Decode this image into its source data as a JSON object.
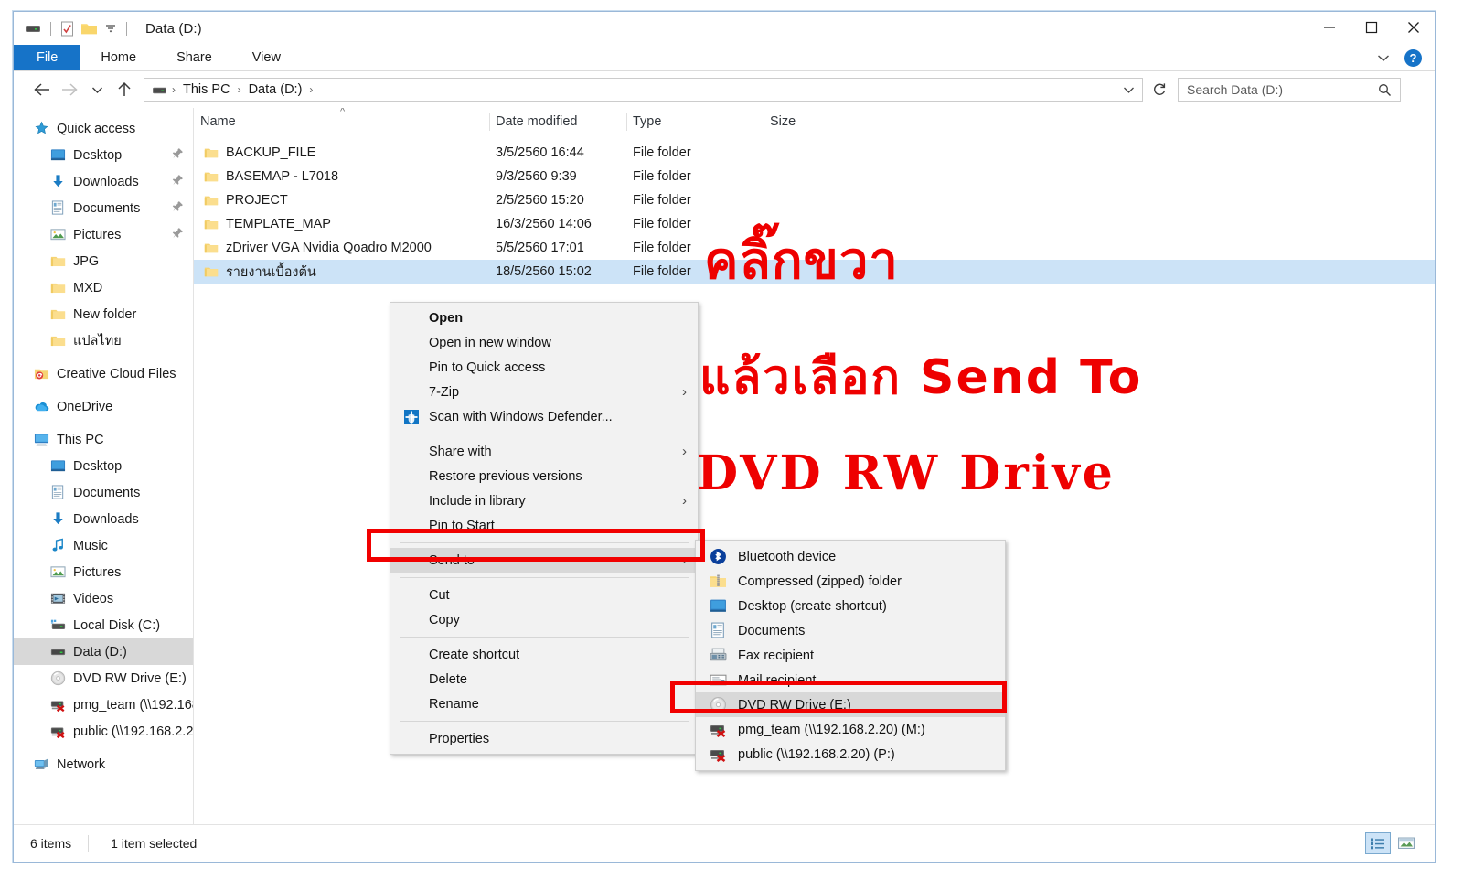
{
  "window": {
    "title": "Data (D:)",
    "quick_access_toolbar": [
      "drive-icon",
      "properties-icon",
      "new-folder-icon",
      "customize-dropdown-icon"
    ],
    "controls": {
      "minimize": "–",
      "maximize": "□",
      "close": "✕"
    }
  },
  "ribbon": {
    "tabs": [
      {
        "label": "File",
        "active": true
      },
      {
        "label": "Home",
        "active": false
      },
      {
        "label": "Share",
        "active": false
      },
      {
        "label": "View",
        "active": false
      }
    ],
    "collapse_label": "⌄",
    "help_label": "?"
  },
  "navbar": {
    "back": "←",
    "forward": "→",
    "recent": "⌄",
    "up": "↑",
    "breadcrumbs": [
      "This PC",
      "Data (D:)"
    ],
    "dropdown": "⌄",
    "refresh": "↻"
  },
  "search": {
    "placeholder": "Search Data (D:)",
    "value": ""
  },
  "sidebar": {
    "items": [
      {
        "label": "Quick access",
        "icon": "star-icon",
        "indent": 0,
        "pinned": false,
        "selected": false
      },
      {
        "label": "Desktop",
        "icon": "desktop-icon",
        "indent": 1,
        "pinned": true,
        "selected": false
      },
      {
        "label": "Downloads",
        "icon": "downloads-icon",
        "indent": 1,
        "pinned": true,
        "selected": false
      },
      {
        "label": "Documents",
        "icon": "documents-icon",
        "indent": 1,
        "pinned": true,
        "selected": false
      },
      {
        "label": "Pictures",
        "icon": "pictures-icon",
        "indent": 1,
        "pinned": true,
        "selected": false
      },
      {
        "label": "JPG",
        "icon": "folder-icon",
        "indent": 1,
        "pinned": false,
        "selected": false
      },
      {
        "label": "MXD",
        "icon": "folder-icon",
        "indent": 1,
        "pinned": false,
        "selected": false
      },
      {
        "label": "New folder",
        "icon": "folder-icon",
        "indent": 1,
        "pinned": false,
        "selected": false
      },
      {
        "label": "แปลไทย",
        "icon": "folder-icon",
        "indent": 1,
        "pinned": false,
        "selected": false
      },
      {
        "label": "Creative Cloud Files",
        "icon": "creative-cloud-icon",
        "indent": 0,
        "pinned": false,
        "selected": false
      },
      {
        "label": "OneDrive",
        "icon": "onedrive-icon",
        "indent": 0,
        "pinned": false,
        "selected": false
      },
      {
        "label": "This PC",
        "icon": "this-pc-icon",
        "indent": 0,
        "pinned": false,
        "selected": false
      },
      {
        "label": "Desktop",
        "icon": "desktop-icon",
        "indent": 1,
        "pinned": false,
        "selected": false
      },
      {
        "label": "Documents",
        "icon": "documents-icon",
        "indent": 1,
        "pinned": false,
        "selected": false
      },
      {
        "label": "Downloads",
        "icon": "downloads-icon",
        "indent": 1,
        "pinned": false,
        "selected": false
      },
      {
        "label": "Music",
        "icon": "music-icon",
        "indent": 1,
        "pinned": false,
        "selected": false
      },
      {
        "label": "Pictures",
        "icon": "pictures-icon",
        "indent": 1,
        "pinned": false,
        "selected": false
      },
      {
        "label": "Videos",
        "icon": "videos-icon",
        "indent": 1,
        "pinned": false,
        "selected": false
      },
      {
        "label": "Local Disk (C:)",
        "icon": "local-disk-icon",
        "indent": 1,
        "pinned": false,
        "selected": false
      },
      {
        "label": "Data (D:)",
        "icon": "drive-icon",
        "indent": 1,
        "pinned": false,
        "selected": true
      },
      {
        "label": "DVD RW Drive (E:)",
        "icon": "dvd-drive-icon",
        "indent": 1,
        "pinned": false,
        "selected": false
      },
      {
        "label": "pmg_team (\\\\192.168",
        "icon": "network-drive-disconnected-icon",
        "indent": 1,
        "pinned": false,
        "selected": false
      },
      {
        "label": "public (\\\\192.168.2.2",
        "icon": "network-drive-disconnected-icon",
        "indent": 1,
        "pinned": false,
        "selected": false
      },
      {
        "label": "Network",
        "icon": "network-icon",
        "indent": 0,
        "pinned": false,
        "selected": false
      }
    ]
  },
  "filelist": {
    "columns": [
      "Name",
      "Date modified",
      "Type",
      "Size"
    ],
    "sort_indicator": "^",
    "rows": [
      {
        "name": "BACKUP_FILE",
        "date": "3/5/2560 16:44",
        "type": "File folder",
        "size": "",
        "selected": false
      },
      {
        "name": "BASEMAP - L7018",
        "date": "9/3/2560 9:39",
        "type": "File folder",
        "size": "",
        "selected": false
      },
      {
        "name": "PROJECT",
        "date": "2/5/2560 15:20",
        "type": "File folder",
        "size": "",
        "selected": false
      },
      {
        "name": "TEMPLATE_MAP",
        "date": "16/3/2560 14:06",
        "type": "File folder",
        "size": "",
        "selected": false
      },
      {
        "name": "zDriver VGA Nvidia Qoadro M2000",
        "date": "5/5/2560 17:01",
        "type": "File folder",
        "size": "",
        "selected": false
      },
      {
        "name": "รายงานเบื้องต้น",
        "date": "18/5/2560 15:02",
        "type": "File folder",
        "size": "",
        "selected": true
      }
    ]
  },
  "context_menu": {
    "items": [
      {
        "label": "Open",
        "bold": true,
        "arrow": false,
        "icon": null,
        "highlighted": false
      },
      {
        "label": "Open in new window",
        "bold": false,
        "arrow": false,
        "icon": null,
        "highlighted": false
      },
      {
        "label": "Pin to Quick access",
        "bold": false,
        "arrow": false,
        "icon": null,
        "highlighted": false
      },
      {
        "label": "7-Zip",
        "bold": false,
        "arrow": true,
        "icon": null,
        "highlighted": false
      },
      {
        "label": "Scan with Windows Defender...",
        "bold": false,
        "arrow": false,
        "icon": "windows-defender-icon",
        "highlighted": false
      },
      {
        "separator": true
      },
      {
        "label": "Share with",
        "bold": false,
        "arrow": true,
        "icon": null,
        "highlighted": false
      },
      {
        "label": "Restore previous versions",
        "bold": false,
        "arrow": false,
        "icon": null,
        "highlighted": false
      },
      {
        "label": "Include in library",
        "bold": false,
        "arrow": true,
        "icon": null,
        "highlighted": false
      },
      {
        "label": "Pin to Start",
        "bold": false,
        "arrow": false,
        "icon": null,
        "highlighted": false
      },
      {
        "separator": true
      },
      {
        "label": "Send to",
        "bold": false,
        "arrow": true,
        "icon": null,
        "highlighted": true
      },
      {
        "separator": true
      },
      {
        "label": "Cut",
        "bold": false,
        "arrow": false,
        "icon": null,
        "highlighted": false
      },
      {
        "label": "Copy",
        "bold": false,
        "arrow": false,
        "icon": null,
        "highlighted": false
      },
      {
        "separator": true
      },
      {
        "label": "Create shortcut",
        "bold": false,
        "arrow": false,
        "icon": null,
        "highlighted": false
      },
      {
        "label": "Delete",
        "bold": false,
        "arrow": false,
        "icon": null,
        "highlighted": false
      },
      {
        "label": "Rename",
        "bold": false,
        "arrow": false,
        "icon": null,
        "highlighted": false
      },
      {
        "separator": true
      },
      {
        "label": "Properties",
        "bold": false,
        "arrow": false,
        "icon": null,
        "highlighted": false
      }
    ]
  },
  "send_to_submenu": {
    "items": [
      {
        "label": "Bluetooth device",
        "icon": "bluetooth-icon",
        "highlighted": false
      },
      {
        "label": "Compressed (zipped) folder",
        "icon": "zip-folder-icon",
        "highlighted": false
      },
      {
        "label": "Desktop (create shortcut)",
        "icon": "desktop-icon",
        "highlighted": false
      },
      {
        "label": "Documents",
        "icon": "documents-icon",
        "highlighted": false
      },
      {
        "label": "Fax recipient",
        "icon": "fax-icon",
        "highlighted": false
      },
      {
        "label": "Mail recipient",
        "icon": "mail-icon",
        "highlighted": false
      },
      {
        "label": "DVD RW Drive (E:)",
        "icon": "dvd-drive-icon",
        "highlighted": true
      },
      {
        "label": "pmg_team (\\\\192.168.2.20) (M:)",
        "icon": "network-drive-disconnected-icon",
        "highlighted": false
      },
      {
        "label": "public (\\\\192.168.2.20) (P:)",
        "icon": "network-drive-disconnected-icon",
        "highlighted": false
      }
    ]
  },
  "statusbar": {
    "item_count": "6 items",
    "selection": "1 item selected",
    "views": [
      {
        "name": "details-view-button",
        "active": true
      },
      {
        "name": "large-icons-view-button",
        "active": false
      }
    ]
  },
  "annotations": {
    "color": "#ee0000",
    "line1": "คลิ๊กขวา",
    "line2": "แล้วเลือก  Send  To",
    "line3": "DVD  RW  Drive",
    "highlight_boxes": [
      "send-to-menu-item",
      "dvd-rw-drive-submenu-item"
    ]
  }
}
